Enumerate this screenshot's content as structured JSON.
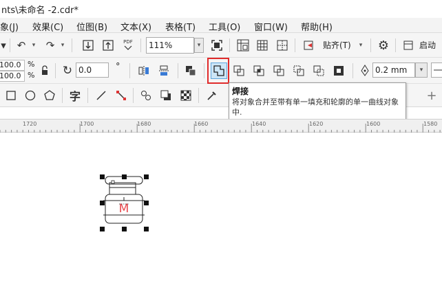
{
  "window": {
    "title": "nts\\未命名 -2.cdr*"
  },
  "menu": [
    {
      "label": "象(J)"
    },
    {
      "label": "效果(C)"
    },
    {
      "label": "位图(B)"
    },
    {
      "label": "文本(X)"
    },
    {
      "label": "表格(T)"
    },
    {
      "label": "工具(O)"
    },
    {
      "label": "窗口(W)"
    },
    {
      "label": "帮助(H)"
    }
  ],
  "standard_toolbar": {
    "zoom_value": "111%",
    "snap_label": "贴齐(T)",
    "launch_label": "启动",
    "pdf_label": "PDF"
  },
  "property_bar": {
    "scale_x": "100.0",
    "scale_y": "100.0",
    "percent_sign": "%",
    "rotation": "0.0",
    "degree_sign": "°",
    "outline_width": "0.2 mm"
  },
  "toolbox": {
    "text_tool_glyph": "字"
  },
  "tooltip": {
    "title": "焊接",
    "body": "将对象合并至带有单一填充和轮廓的单一曲线对象中."
  },
  "ruler": {
    "ticks": [
      "1720",
      "1700",
      "1680",
      "1660",
      "1640",
      "1620",
      "1600",
      "1580"
    ]
  },
  "canvas_object": {
    "logo_letter": "M",
    "logo_color": "#e8474c"
  },
  "colors": {
    "highlight_border": "#e02a2a",
    "active_button_bg": "#cde6f7"
  },
  "icons": [
    "undo-icon",
    "redo-icon",
    "import-icon",
    "export-icon",
    "pdf-icon",
    "fullscreen-icon",
    "ruler-icon",
    "grid-icon",
    "guidelines-icon",
    "snap-icon",
    "options-gear-icon",
    "lock-ratio-icon",
    "rotate-icon",
    "mirror-horizontal-icon",
    "mirror-vertical-icon",
    "arrange-icon",
    "weld-icon",
    "trim-icon",
    "intersect-icon",
    "simplify-icon",
    "front-minus-back-icon",
    "back-minus-front-icon",
    "boundary-icon",
    "pen-outline-icon",
    "rectangle-tool-icon",
    "ellipse-tool-icon",
    "polygon-tool-icon",
    "text-tool-icon",
    "line-tool-icon",
    "connector-tool-icon",
    "blend-tool-icon",
    "shadow-tool-icon",
    "transparency-tool-icon",
    "eyedropper-tool-icon",
    "add-icon"
  ]
}
